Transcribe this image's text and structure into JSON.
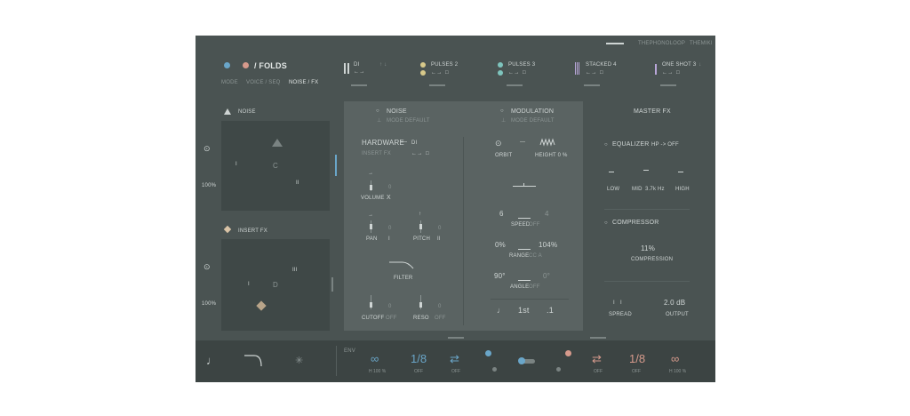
{
  "brand": {
    "logo_mark": "THEPHONOLOOP",
    "product": "THEMIKI"
  },
  "header": {
    "title": "/ FOLDS",
    "tabs": [
      {
        "label": "MODE"
      },
      {
        "label": "VOICE / SEQ"
      },
      {
        "label": "NOISE / FX"
      }
    ],
    "slots": [
      {
        "name": "DI"
      },
      {
        "name": "PULSES 2"
      },
      {
        "name": "PULSES 3"
      },
      {
        "name": "STACKED 4"
      },
      {
        "name": "ONE SHOT 3"
      }
    ],
    "slot_arrows": "←→",
    "slot_square": "□"
  },
  "left": {
    "noise_label": "NOISE",
    "noise_pct": "100%",
    "noise_markers": {
      "i": "I",
      "c": "C",
      "ii": "II"
    },
    "insert_label": "INSERT FX",
    "insert_pct": "100%",
    "insert_markers": {
      "i": "I",
      "d": "D",
      "iii": "III"
    }
  },
  "center": {
    "noise": {
      "title": "NOISE",
      "sub": "MODE DEFAULT"
    },
    "modulation": {
      "title": "MODULATION",
      "sub": "MODE DEFAULT"
    },
    "hardware": {
      "title": "HARDWARE",
      "dash": "—",
      "value": "DI",
      "insert_fx": "INSERT FX",
      "arrows": "←→",
      "square": "□"
    },
    "volume": {
      "label": "VOLUME",
      "value": "0",
      "x": "X"
    },
    "pan": {
      "label": "PAN",
      "value": "0",
      "mark": "I"
    },
    "pitch": {
      "label": "PITCH",
      "value": "0",
      "mark": "II"
    },
    "filter": {
      "label": "FILTER"
    },
    "cutoff": {
      "label": "CUTOFF",
      "value": "0",
      "state": "OFF"
    },
    "reso": {
      "label": "RESO",
      "value": "0",
      "state": "OFF"
    },
    "orbit": {
      "label": "ORBIT"
    },
    "height": {
      "label": "HEIGHT 0 %"
    },
    "speed": {
      "label": "SPEED",
      "state": "OFF",
      "left": "6",
      "right": "4"
    },
    "range": {
      "label": "RANGE",
      "state": "CC A",
      "left": "0%",
      "right": "104%"
    },
    "angle": {
      "label": "ANGLE",
      "state": "OFF",
      "left": "90°",
      "right": "0°"
    },
    "seq": {
      "note": "♩",
      "value": "1st",
      "end": ".1"
    }
  },
  "master": {
    "title": "MASTER FX",
    "equalizer": {
      "title": "EQUALIZER",
      "hp": "HP -> OFF",
      "low": "LOW",
      "mid": "MID",
      "mid_val": "3.7k Hz",
      "high": "HIGH"
    },
    "compressor": {
      "title": "COMPRESSOR",
      "value": "11%",
      "label": "COMPRESSION"
    },
    "spread": {
      "label": "SPREAD",
      "mark": "I"
    },
    "output": {
      "label": "OUTPUT",
      "value": "2.0 dB"
    }
  },
  "footer": {
    "note": "♩",
    "env": "ENV",
    "items": [
      {
        "big": "∞",
        "label": "H  100 %",
        "color": "blue"
      },
      {
        "big": "1/8",
        "label": "OFF",
        "color": "blue"
      },
      {
        "big": "⇄",
        "label": "OFF",
        "color": "blue"
      },
      {
        "big": "⇄",
        "label": "OFF",
        "color": "red"
      },
      {
        "big": "1/8",
        "label": "OFF",
        "color": "red"
      },
      {
        "big": "∞",
        "label": "H  100 %",
        "color": "red"
      }
    ]
  },
  "colors": {
    "bg": "#4a5352",
    "panel": "#5a6362",
    "blue": "#6aa6c9",
    "red": "#d69a8c",
    "yellow": "#d7c98a",
    "teal": "#7ec4bd",
    "purple": "#b9a6d9"
  }
}
